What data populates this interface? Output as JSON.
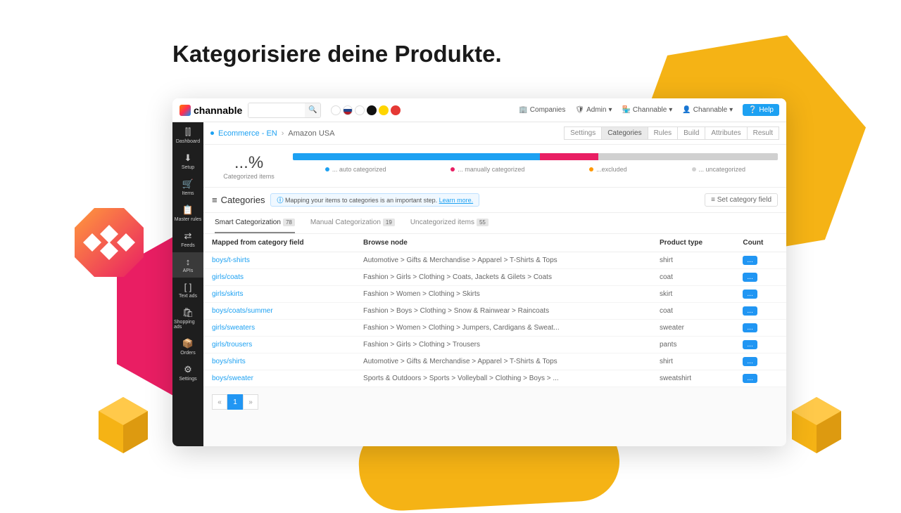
{
  "headline": "Kategorisiere deine Produkte.",
  "brand": "channable",
  "colors": {
    "accent": "#1da1f2",
    "blue": "#2196f3",
    "pink": "#e91e63",
    "orange": "#ff9800",
    "grey": "#d0d0d0"
  },
  "topbar": {
    "companies": "Companies",
    "admin": "Admin",
    "account": "Channable",
    "user": "Channable",
    "help": "Help"
  },
  "circles": [
    {
      "bg": "#fff",
      "border": "#ddd"
    },
    {
      "bg": "linear-gradient(#fff 33%,#21468b 33% 66%,#ae1c28 66%)",
      "border": "#ddd"
    },
    {
      "bg": "#fff",
      "border": "#ddd"
    },
    {
      "bg": "#111",
      "border": "#111"
    },
    {
      "bg": "#ffd500",
      "border": "#ffd500"
    },
    {
      "bg": "#e53935",
      "border": "#e53935"
    }
  ],
  "sidebar": {
    "items": [
      {
        "icon": "⫿⫿",
        "label": "Dashboard"
      },
      {
        "icon": "⬇",
        "label": "Setup"
      },
      {
        "icon": "🛒",
        "label": "Items"
      },
      {
        "icon": "📋",
        "label": "Master rules"
      },
      {
        "icon": "⇄",
        "label": "Feeds"
      },
      {
        "icon": "↕",
        "label": "APIs"
      },
      {
        "icon": "[ ]",
        "label": "Text ads"
      },
      {
        "icon": "🛍",
        "label": "Shopping ads"
      },
      {
        "icon": "📦",
        "label": "Orders"
      },
      {
        "icon": "⚙",
        "label": "Settings"
      }
    ],
    "active_index": 5
  },
  "breadcrumb": {
    "root": "Ecommerce - EN",
    "child": "Amazon USA"
  },
  "steps": {
    "items": [
      "Settings",
      "Categories",
      "Rules",
      "Build",
      "Attributes",
      "Result"
    ],
    "active_index": 1
  },
  "stats": {
    "percent": "...%",
    "label": "Categorized items",
    "bar": [
      {
        "color": "#1da1f2",
        "width": 51
      },
      {
        "color": "#e91e63",
        "width": 12
      },
      {
        "color": "#d0d0d0",
        "width": 37
      }
    ],
    "legend": [
      {
        "color": "#1da1f2",
        "text": "... auto categorized"
      },
      {
        "color": "#e91e63",
        "text": "... manually categorized"
      },
      {
        "color": "#ff9800",
        "text": "...excluded"
      },
      {
        "color": "#d0d0d0",
        "text": "... uncategorized"
      }
    ]
  },
  "section": {
    "title": "Categories",
    "info_text": "Mapping your items to categories is an important step.",
    "learn_more": "Learn more.",
    "set_field_btn": "Set category field"
  },
  "tabs": {
    "items": [
      {
        "label": "Smart Categorization",
        "badge": "78"
      },
      {
        "label": "Manual Categorization",
        "badge": "19"
      },
      {
        "label": "Uncategorized items",
        "badge": "55"
      }
    ],
    "active_index": 0
  },
  "table": {
    "headers": [
      "Mapped from category field",
      "Browse node",
      "Product type",
      "Count"
    ],
    "rows": [
      {
        "mapped": "boys/t-shirts",
        "node": "Automotive > Gifts & Merchandise > Apparel > T-Shirts & Tops",
        "type": "shirt"
      },
      {
        "mapped": "girls/coats",
        "node": "Fashion > Girls > Clothing > Coats, Jackets & Gilets > Coats",
        "type": "coat"
      },
      {
        "mapped": "girls/skirts",
        "node": "Fashion > Women > Clothing > Skirts",
        "type": "skirt"
      },
      {
        "mapped": "boys/coats/summer",
        "node": "Fashion > Boys > Clothing > Snow & Rainwear > Raincoats",
        "type": "coat"
      },
      {
        "mapped": "girls/sweaters",
        "node": "Fashion > Women > Clothing > Jumpers, Cardigans & Sweat...",
        "type": "sweater"
      },
      {
        "mapped": "girls/trousers",
        "node": "Fashion > Girls > Clothing > Trousers",
        "type": "pants"
      },
      {
        "mapped": "boys/shirts",
        "node": "Automotive > Gifts & Merchandise > Apparel > T-Shirts & Tops",
        "type": "shirt"
      },
      {
        "mapped": "boys/sweater",
        "node": "Sports & Outdoors > Sports > Volleyball > Clothing > Boys > ...",
        "type": "sweatshirt"
      }
    ]
  },
  "pager": {
    "prev": "«",
    "page": "1",
    "next": "»"
  }
}
